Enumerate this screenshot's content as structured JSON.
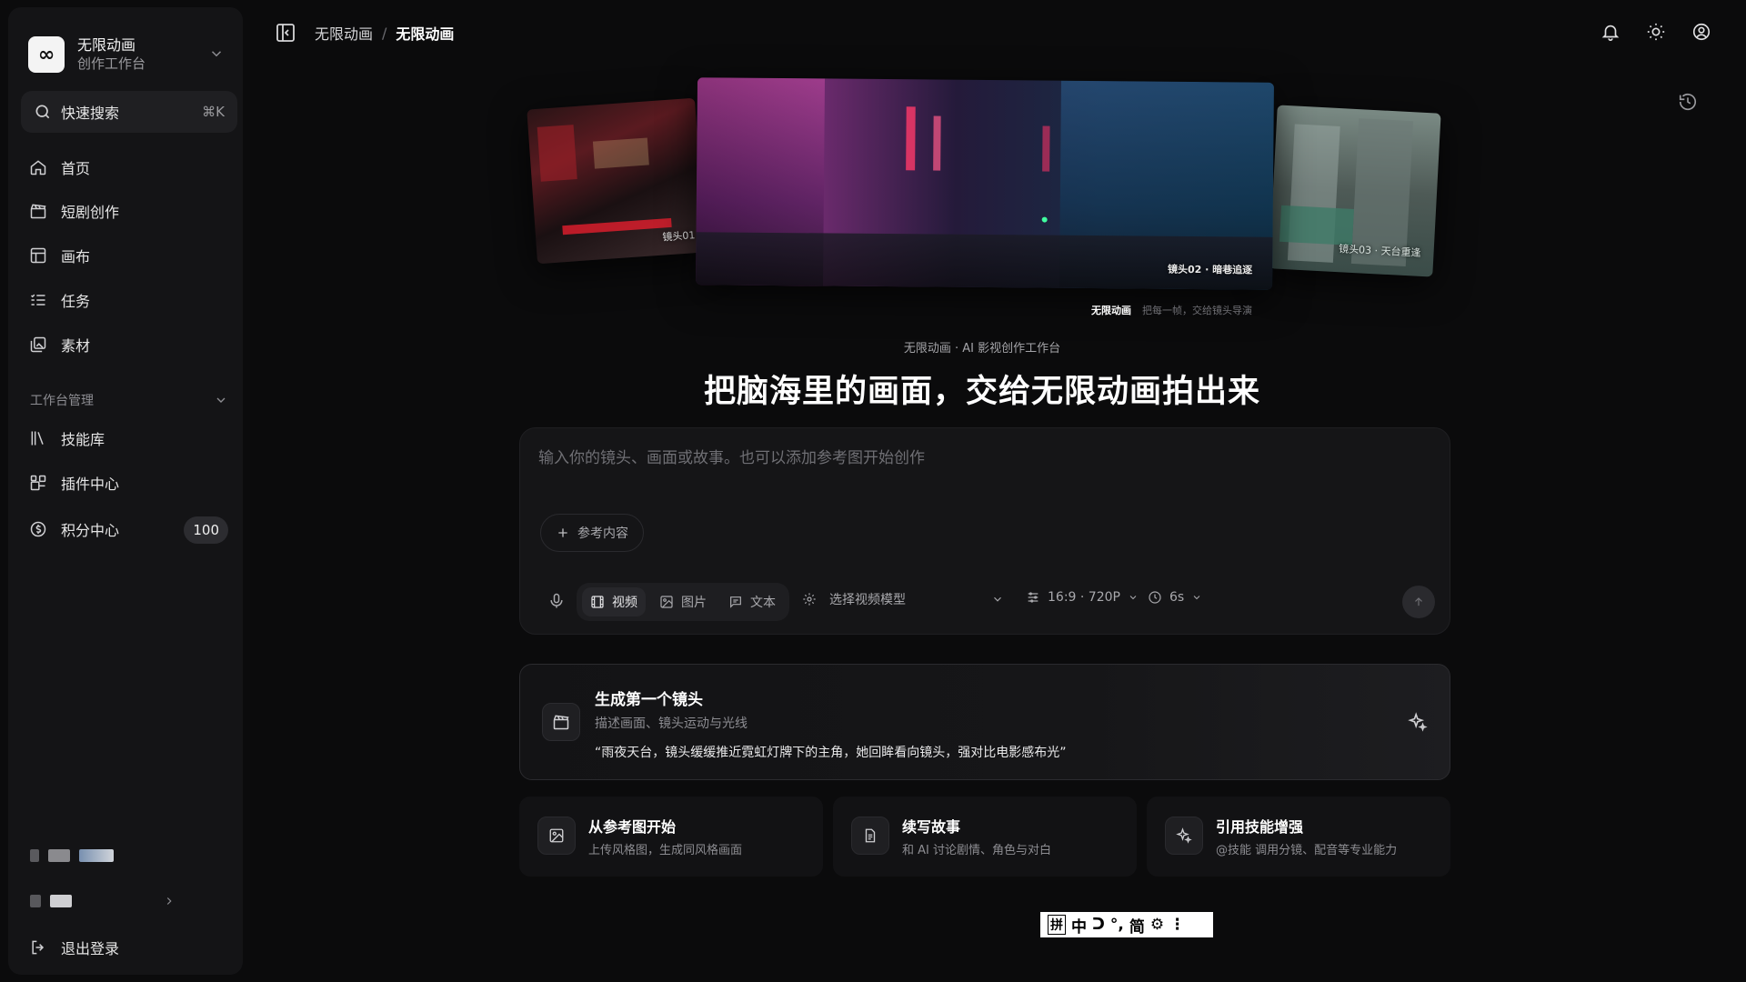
{
  "workspace": {
    "logo": "∞",
    "name": "无限动画",
    "subtitle": "创作工作台"
  },
  "search": {
    "label": "快速搜索",
    "shortcut": "⌘K"
  },
  "nav": [
    {
      "label": "首页",
      "icon": "home-icon"
    },
    {
      "label": "短剧创作",
      "icon": "clapperboard-icon"
    },
    {
      "label": "画布",
      "icon": "layout-icon"
    },
    {
      "label": "任务",
      "icon": "tasks-icon"
    },
    {
      "label": "素材",
      "icon": "images-icon"
    }
  ],
  "manage": {
    "title": "工作台管理",
    "items": [
      {
        "label": "技能库",
        "icon": "library-icon"
      },
      {
        "label": "插件中心",
        "icon": "plugin-icon"
      },
      {
        "label": "积分中心",
        "icon": "coin-icon",
        "badge": "100"
      }
    ]
  },
  "logout": "退出登录",
  "breadcrumb": {
    "parent": "无限动画",
    "separator": "/",
    "current": "无限动画"
  },
  "hero": {
    "frames": [
      {
        "caption": "镜头01"
      },
      {
        "caption": "镜头02 · 暗巷追逐"
      },
      {
        "caption": "镜头03 · 天台重逢"
      }
    ],
    "caption_brand": "无限动画",
    "caption_text": "把每一帧，交给镜头导演"
  },
  "subtitle": "无限动画 · AI 影视创作工作台",
  "headline": "把脑海里的画面，交给无限动画拍出来",
  "prompt": {
    "placeholder": "输入你的镜头、画面或故事。也可以添加参考图开始创作",
    "ref_button": "参考内容",
    "modes": [
      "视频",
      "图片",
      "文本"
    ],
    "active_mode": "视频",
    "model_placeholder": "选择视频模型",
    "ratio": "16:9 · 720P",
    "duration": "6s"
  },
  "first_shot": {
    "title": "生成第一个镜头",
    "subtitle": "描述画面、镜头运动与光线",
    "example": "“雨夜天台，镜头缓缓推近霓虹灯牌下的主角，她回眸看向镜头，强对比电影感布光”"
  },
  "quick_cards": [
    {
      "title": "从参考图开始",
      "subtitle": "上传风格图，生成同风格画面",
      "icon": "image-icon"
    },
    {
      "title": "续写故事",
      "subtitle": "和 AI 讨论剧情、角色与对白",
      "icon": "document-icon"
    },
    {
      "title": "引用技能增强",
      "subtitle": "@技能 调用分镜、配音等专业能力",
      "icon": "sparkle-icon"
    }
  ],
  "ime": {
    "items": [
      "拼",
      "中",
      "ᑐ",
      "°,",
      "简",
      "⚙",
      "⋮"
    ]
  },
  "colors": {
    "background": "#0b0b0c",
    "sidebar": "#141416",
    "accent": "#ffffff"
  }
}
